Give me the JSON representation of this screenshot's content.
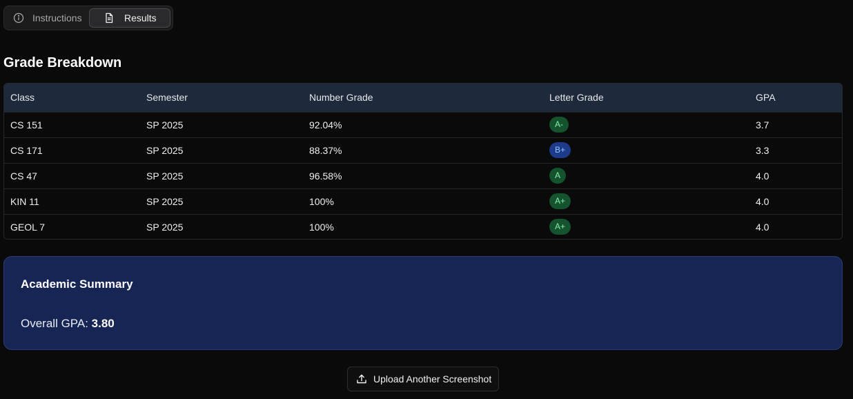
{
  "tabs": [
    {
      "label": "Instructions",
      "icon": "info-icon",
      "active": false
    },
    {
      "label": "Results",
      "icon": "document-icon",
      "active": true
    }
  ],
  "section_title": "Grade Breakdown",
  "table": {
    "headers": [
      "Class",
      "Semester",
      "Number Grade",
      "Letter Grade",
      "GPA"
    ],
    "rows": [
      {
        "class": "CS 151",
        "semester": "SP 2025",
        "number_grade": "92.04%",
        "letter_grade": "A-",
        "gpa": "3.7"
      },
      {
        "class": "CS 171",
        "semester": "SP 2025",
        "number_grade": "88.37%",
        "letter_grade": "B+",
        "gpa": "3.3"
      },
      {
        "class": "CS 47",
        "semester": "SP 2025",
        "number_grade": "96.58%",
        "letter_grade": "A",
        "gpa": "4.0"
      },
      {
        "class": "KIN 11",
        "semester": "SP 2025",
        "number_grade": "100%",
        "letter_grade": "A+",
        "gpa": "4.0"
      },
      {
        "class": "GEOL 7",
        "semester": "SP 2025",
        "number_grade": "100%",
        "letter_grade": "A+",
        "gpa": "4.0"
      }
    ]
  },
  "badge_colors": {
    "A": {
      "bg": "#14532d",
      "fg": "#86efac"
    },
    "B": {
      "bg": "#1e3a8a",
      "fg": "#93c5fd"
    }
  },
  "summary": {
    "title": "Academic Summary",
    "gpa_label": "Overall GPA:",
    "gpa_value": "3.80"
  },
  "upload_button": {
    "label": "Upload Another Screenshot",
    "icon": "upload-icon"
  },
  "colors": {
    "background": "#0a0a0a",
    "table_header": "#1e293b",
    "summary_bg": "#172554"
  }
}
